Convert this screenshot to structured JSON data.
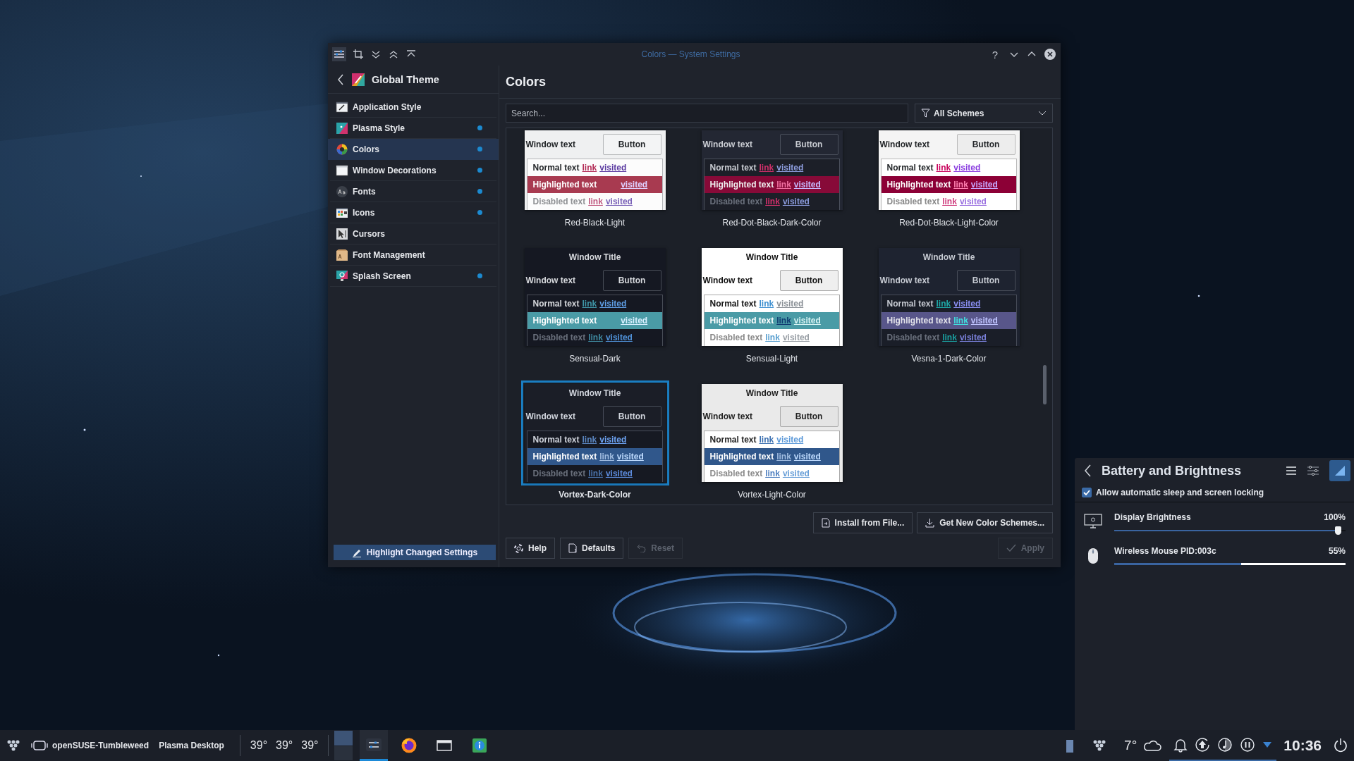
{
  "window": {
    "title": "Colors — System Settings",
    "help": "?"
  },
  "sidebar": {
    "header": "Global Theme",
    "items": [
      {
        "label": "Application Style",
        "selected": false,
        "changed": false
      },
      {
        "label": "Plasma Style",
        "selected": false,
        "changed": true
      },
      {
        "label": "Colors",
        "selected": true,
        "changed": true
      },
      {
        "label": "Window Decorations",
        "selected": false,
        "changed": true
      },
      {
        "label": "Fonts",
        "selected": false,
        "changed": true
      },
      {
        "label": "Icons",
        "selected": false,
        "changed": true
      },
      {
        "label": "Cursors",
        "selected": false,
        "changed": false
      },
      {
        "label": "Font Management",
        "selected": false,
        "changed": false
      },
      {
        "label": "Splash Screen",
        "selected": false,
        "changed": true
      }
    ],
    "highlight_button": "Highlight Changed Settings"
  },
  "page": {
    "heading": "Colors",
    "search": {
      "placeholder": "Search..."
    },
    "filter": "All Schemes",
    "schemes": [
      {
        "name": "Red-Black-Light",
        "selected": false,
        "window_text": "Window text",
        "button": "Button",
        "rows": [
          {
            "text": "Normal text",
            "link": "link",
            "visited": "visited"
          },
          {
            "text": "Highlighted text",
            "visited": "visited"
          },
          {
            "text": "Disabled text",
            "link": "link",
            "visited": "visited"
          }
        ]
      },
      {
        "name": "Red-Dot-Black-Dark-Color",
        "selected": false,
        "window_text": "Window text",
        "button": "Button",
        "rows": [
          {
            "text": "Normal text",
            "link": "link",
            "visited": "visited"
          },
          {
            "text": "Highlighted text",
            "link": "link",
            "visited": "visited"
          },
          {
            "text": "Disabled text",
            "link": "link",
            "visited": "visited"
          }
        ]
      },
      {
        "name": "Red-Dot-Black-Light-Color",
        "selected": false,
        "window_text": "Window text",
        "button": "Button",
        "rows": [
          {
            "text": "Normal text",
            "link": "link",
            "visited": "visited"
          },
          {
            "text": "Highlighted text",
            "link": "link",
            "visited": "visited"
          },
          {
            "text": "Disabled text",
            "link": "link",
            "visited": "visited"
          }
        ]
      },
      {
        "name": "Sensual-Dark",
        "selected": false,
        "title": "Window Title",
        "window_text": "Window text",
        "button": "Button",
        "rows": [
          {
            "text": "Normal text",
            "link": "link",
            "visited": "visited"
          },
          {
            "text": "Highlighted text",
            "visited": "visited"
          },
          {
            "text": "Disabled text",
            "link": "link",
            "visited": "visited"
          }
        ]
      },
      {
        "name": "Sensual-Light",
        "selected": false,
        "title": "Window Title",
        "window_text": "Window text",
        "button": "Button",
        "rows": [
          {
            "text": "Normal text",
            "link": "link",
            "visited": "visited"
          },
          {
            "text": "Highlighted text",
            "link": "link",
            "visited": "visited"
          },
          {
            "text": "Disabled text",
            "link": "link",
            "visited": "visited"
          }
        ]
      },
      {
        "name": "Vesna-1-Dark-Color",
        "selected": false,
        "title": "Window Title",
        "window_text": "Window text",
        "button": "Button",
        "rows": [
          {
            "text": "Normal text",
            "link": "link",
            "visited": "visited"
          },
          {
            "text": "Highlighted text",
            "link": "link",
            "visited": "visited"
          },
          {
            "text": "Disabled text",
            "link": "link",
            "visited": "visited"
          }
        ]
      },
      {
        "name": "Vortex-Dark-Color",
        "selected": true,
        "title": "Window Title",
        "window_text": "Window text",
        "button": "Button",
        "rows": [
          {
            "text": "Normal text",
            "link": "link",
            "visited": "visited"
          },
          {
            "text": "Highlighted text",
            "link": "link",
            "visited": "visited"
          },
          {
            "text": "Disabled text",
            "link": "link",
            "visited": "visited"
          }
        ]
      },
      {
        "name": "Vortex-Light-Color",
        "selected": false,
        "title": "Window Title",
        "window_text": "Window text",
        "button": "Button",
        "rows": [
          {
            "text": "Normal text",
            "link": "link",
            "visited": "visited"
          },
          {
            "text": "Highlighted text",
            "link": "link",
            "visited": "visited"
          },
          {
            "text": "Disabled text",
            "link": "link",
            "visited": "visited"
          }
        ]
      }
    ],
    "actions": [
      "Install from File...",
      "Get New Color Schemes..."
    ],
    "footer": [
      {
        "label": "Help",
        "disabled": false
      },
      {
        "label": "Defaults",
        "disabled": false
      },
      {
        "label": "Reset",
        "disabled": true
      },
      {
        "label": "Apply",
        "disabled": true
      }
    ]
  },
  "battery_panel": {
    "title": "Battery and Brightness",
    "pinned": true,
    "inhibit": {
      "label": "Allow automatic sleep and screen locking",
      "checked": true
    },
    "devices": [
      {
        "kind": "slider",
        "name": "Display Brightness",
        "reading": "100%",
        "level": 1.0
      },
      {
        "kind": "battery",
        "name": "Wireless Mouse PID:003c",
        "reading": "55%",
        "level": 0.55
      }
    ]
  },
  "taskbar": {
    "labels": [
      "openSUSE-Tumbleweed",
      "Plasma Desktop"
    ],
    "temperatures": [
      "39°",
      "39°",
      "39°"
    ],
    "desktops": [
      {
        "selected": true
      },
      {
        "selected": false
      }
    ],
    "tasks": [
      {
        "selected": true
      },
      {
        "selected": false
      },
      {
        "selected": false
      },
      {
        "selected": false
      }
    ],
    "weather": "7°",
    "clock": "10:36"
  }
}
